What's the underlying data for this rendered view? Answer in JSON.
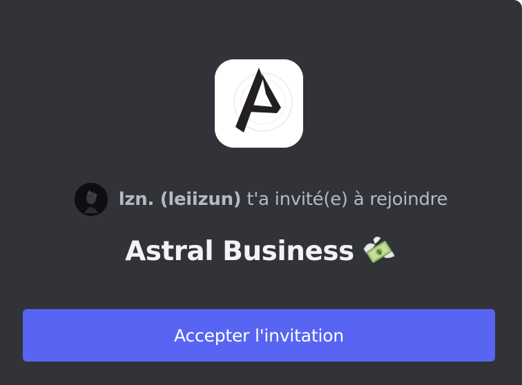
{
  "invite": {
    "inviter_name": "lzn. (leiizun)",
    "invite_text": " t'a invité(e) à rejoindre",
    "server_name": "Astral Business",
    "server_emoji": "money-with-wings-icon",
    "server_icon": "astral-logo-icon"
  },
  "actions": {
    "accept_label": "Accepter l'invitation"
  },
  "colors": {
    "background": "#313338",
    "button": "#5865f2",
    "muted_text": "#b5bac1",
    "heading_text": "#f2f3f5"
  }
}
